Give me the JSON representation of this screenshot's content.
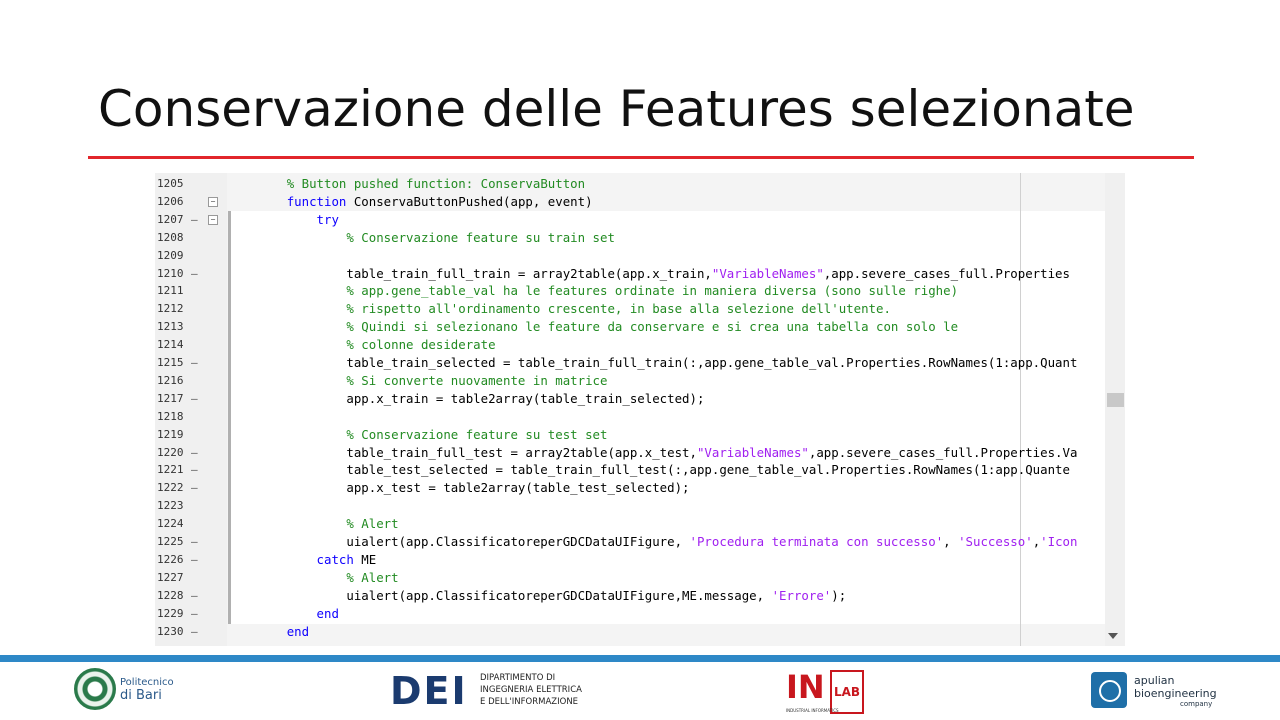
{
  "slide": {
    "title": "Conservazione delle Features selezionate"
  },
  "colors": {
    "title_rule": "#e2262b",
    "footer_bar": "#2e88c7",
    "keyword": "#0e00ff",
    "comment": "#228b22",
    "string": "#a020f0"
  },
  "code_lines": [
    {
      "n": "1205",
      "marker": "",
      "fold": false,
      "segments": [
        {
          "t": "        ",
          "c": ""
        },
        {
          "t": "% Button pushed function: ConservaButton",
          "c": "cm"
        }
      ]
    },
    {
      "n": "1206",
      "marker": "",
      "fold": true,
      "segments": [
        {
          "t": "        ",
          "c": ""
        },
        {
          "t": "function",
          "c": "kw"
        },
        {
          "t": " ConservaButtonPushed(app, event)",
          "c": ""
        }
      ]
    },
    {
      "n": "1207",
      "marker": "–",
      "fold": true,
      "segments": [
        {
          "t": "            ",
          "c": ""
        },
        {
          "t": "try",
          "c": "kw"
        }
      ]
    },
    {
      "n": "1208",
      "marker": "",
      "fold": false,
      "segments": [
        {
          "t": "                ",
          "c": ""
        },
        {
          "t": "% Conservazione feature su train set",
          "c": "cm"
        }
      ]
    },
    {
      "n": "1209",
      "marker": "",
      "fold": false,
      "segments": []
    },
    {
      "n": "1210",
      "marker": "–",
      "fold": false,
      "segments": [
        {
          "t": "                table_train_full_train = array2table(app.x_train,",
          "c": ""
        },
        {
          "t": "\"VariableNames\"",
          "c": "str"
        },
        {
          "t": ",app.severe_cases_full.Properties",
          "c": ""
        }
      ]
    },
    {
      "n": "1211",
      "marker": "",
      "fold": false,
      "segments": [
        {
          "t": "                ",
          "c": ""
        },
        {
          "t": "% app.gene_table_val ha le features ordinate in maniera diversa (sono sulle righe)",
          "c": "cm"
        }
      ]
    },
    {
      "n": "1212",
      "marker": "",
      "fold": false,
      "segments": [
        {
          "t": "                ",
          "c": ""
        },
        {
          "t": "% rispetto all'ordinamento crescente, in base alla selezione dell'utente.",
          "c": "cm"
        }
      ]
    },
    {
      "n": "1213",
      "marker": "",
      "fold": false,
      "segments": [
        {
          "t": "                ",
          "c": ""
        },
        {
          "t": "% Quindi si selezionano le feature da conservare e si crea una tabella con solo le",
          "c": "cm"
        }
      ]
    },
    {
      "n": "1214",
      "marker": "",
      "fold": false,
      "segments": [
        {
          "t": "                ",
          "c": ""
        },
        {
          "t": "% colonne desiderate",
          "c": "cm"
        }
      ]
    },
    {
      "n": "1215",
      "marker": "–",
      "fold": false,
      "segments": [
        {
          "t": "                table_train_selected = table_train_full_train(:,app.gene_table_val.Properties.RowNames(1:app.Quant",
          "c": ""
        }
      ]
    },
    {
      "n": "1216",
      "marker": "",
      "fold": false,
      "segments": [
        {
          "t": "                ",
          "c": ""
        },
        {
          "t": "% Si converte nuovamente in matrice",
          "c": "cm"
        }
      ]
    },
    {
      "n": "1217",
      "marker": "–",
      "fold": false,
      "segments": [
        {
          "t": "                app.x_train = table2array(table_train_selected);",
          "c": ""
        }
      ]
    },
    {
      "n": "1218",
      "marker": "",
      "fold": false,
      "segments": []
    },
    {
      "n": "1219",
      "marker": "",
      "fold": false,
      "segments": [
        {
          "t": "                ",
          "c": ""
        },
        {
          "t": "% Conservazione feature su test set",
          "c": "cm"
        }
      ]
    },
    {
      "n": "1220",
      "marker": "–",
      "fold": false,
      "segments": [
        {
          "t": "                table_train_full_test = array2table(app.x_test,",
          "c": ""
        },
        {
          "t": "\"VariableNames\"",
          "c": "str"
        },
        {
          "t": ",app.severe_cases_full.Properties.Va",
          "c": ""
        }
      ]
    },
    {
      "n": "1221",
      "marker": "–",
      "fold": false,
      "segments": [
        {
          "t": "                table_test_selected = table_train_full_test(:,app.gene_table_val.Properties.RowNames(1:app.Quante",
          "c": ""
        }
      ]
    },
    {
      "n": "1222",
      "marker": "–",
      "fold": false,
      "segments": [
        {
          "t": "                app.x_test = table2array(table_test_selected);",
          "c": ""
        }
      ]
    },
    {
      "n": "1223",
      "marker": "",
      "fold": false,
      "segments": []
    },
    {
      "n": "1224",
      "marker": "",
      "fold": false,
      "segments": [
        {
          "t": "                ",
          "c": ""
        },
        {
          "t": "% Alert",
          "c": "cm"
        }
      ]
    },
    {
      "n": "1225",
      "marker": "–",
      "fold": false,
      "segments": [
        {
          "t": "                uialert(app.ClassificatoreperGDCDataUIFigure, ",
          "c": ""
        },
        {
          "t": "'Procedura terminata con successo'",
          "c": "str"
        },
        {
          "t": ", ",
          "c": ""
        },
        {
          "t": "'Successo'",
          "c": "str"
        },
        {
          "t": ",",
          "c": ""
        },
        {
          "t": "'Icon",
          "c": "str"
        }
      ]
    },
    {
      "n": "1226",
      "marker": "–",
      "fold": false,
      "segments": [
        {
          "t": "            ",
          "c": ""
        },
        {
          "t": "catch",
          "c": "kw"
        },
        {
          "t": " ME",
          "c": ""
        }
      ]
    },
    {
      "n": "1227",
      "marker": "",
      "fold": false,
      "segments": [
        {
          "t": "                ",
          "c": ""
        },
        {
          "t": "% Alert",
          "c": "cm"
        }
      ]
    },
    {
      "n": "1228",
      "marker": "–",
      "fold": false,
      "segments": [
        {
          "t": "                uialert(app.ClassificatoreperGDCDataUIFigure,ME.message, ",
          "c": ""
        },
        {
          "t": "'Errore'",
          "c": "str"
        },
        {
          "t": ");",
          "c": ""
        }
      ]
    },
    {
      "n": "1229",
      "marker": "–",
      "fold": false,
      "segments": [
        {
          "t": "            ",
          "c": ""
        },
        {
          "t": "end",
          "c": "kw"
        }
      ]
    },
    {
      "n": "1230",
      "marker": "–",
      "fold": false,
      "segments": [
        {
          "t": "        ",
          "c": ""
        },
        {
          "t": "end",
          "c": "kw"
        }
      ]
    }
  ],
  "footer": {
    "polito_line1": "Politecnico",
    "polito_line2": "di Bari",
    "dei_logo": "DEI",
    "dei_text": [
      "DIPARTIMENTO DI",
      "INGEGNERIA ELETTRICA",
      "E DELL'INFORMAZIONE"
    ],
    "inlab_in": "IN",
    "inlab_lab": "LAB",
    "inlab_small": "INDUSTRIAL INFORMATICS",
    "abc_line1": "apulian",
    "abc_line2": "bioengineering",
    "abc_company": "company"
  }
}
